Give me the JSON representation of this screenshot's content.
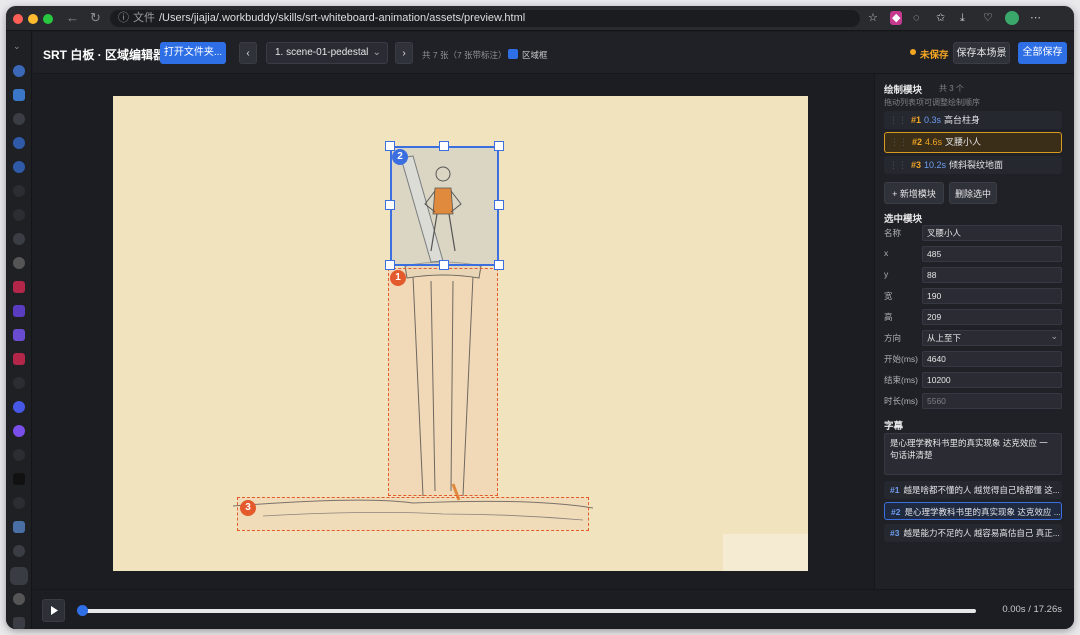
{
  "browser": {
    "address_label": "文件",
    "url": "/Users/jiajia/.workbuddy/skills/srt-whiteboard-animation/assets/preview.html"
  },
  "app": {
    "title": "SRT 白板 · 区域编辑器",
    "open_folder": "打开文件夹...",
    "scene_select": "1. scene-01-pedestal",
    "scene_count": "共 7 张（7 张带标注）",
    "region_box_label": "区域框",
    "unsaved": "未保存",
    "save_scene": "保存本场景",
    "save_all": "全部保存"
  },
  "colors": {
    "accent": "#2f6fe6",
    "region": "#e35b2c",
    "selected_region": "#3b6fe0",
    "warning": "#f4a623"
  },
  "regions": [
    {
      "number": "1"
    },
    {
      "number": "2"
    },
    {
      "number": "3"
    }
  ],
  "panel": {
    "layers_title": "绘制模块",
    "layers_count": "共 3 个",
    "layers_hint": "拖动列表项可调整绘制顺序",
    "layers": [
      {
        "num": "#1",
        "time": "0.3s",
        "name": "高台柱身"
      },
      {
        "num": "#2",
        "time": "4.6s",
        "name": "叉腰小人"
      },
      {
        "num": "#3",
        "time": "10.2s",
        "name": "倾斜裂纹地面"
      }
    ],
    "add_block": "+ 新增模块",
    "delete_selected": "删除选中",
    "selected_title": "选中模块",
    "fields": [
      {
        "label": "名称",
        "value": "叉腰小人"
      },
      {
        "label": "x",
        "value": "485"
      },
      {
        "label": "y",
        "value": "88"
      },
      {
        "label": "宽",
        "value": "190"
      },
      {
        "label": "高",
        "value": "209"
      },
      {
        "label": "方向",
        "value": "从上至下"
      },
      {
        "label": "开始(ms)",
        "value": "4640"
      },
      {
        "label": "结束(ms)",
        "value": "10200"
      },
      {
        "label": "时长(ms)",
        "value": "5560"
      }
    ],
    "subtitle_title": "字幕",
    "subtitle_text": "是心理学教科书里的真实现象 达克效应 一句话讲清楚",
    "subtitles": [
      {
        "num": "#1",
        "text": "越是啥都不懂的人 越觉得自己啥都懂 这..."
      },
      {
        "num": "#2",
        "text": "是心理学教科书里的真实现象 达克效应 ..."
      },
      {
        "num": "#3",
        "text": "越是能力不足的人 越容易高估自己 真正..."
      }
    ]
  },
  "player": {
    "time": "0.00s / 17.26s",
    "progress": 0
  }
}
